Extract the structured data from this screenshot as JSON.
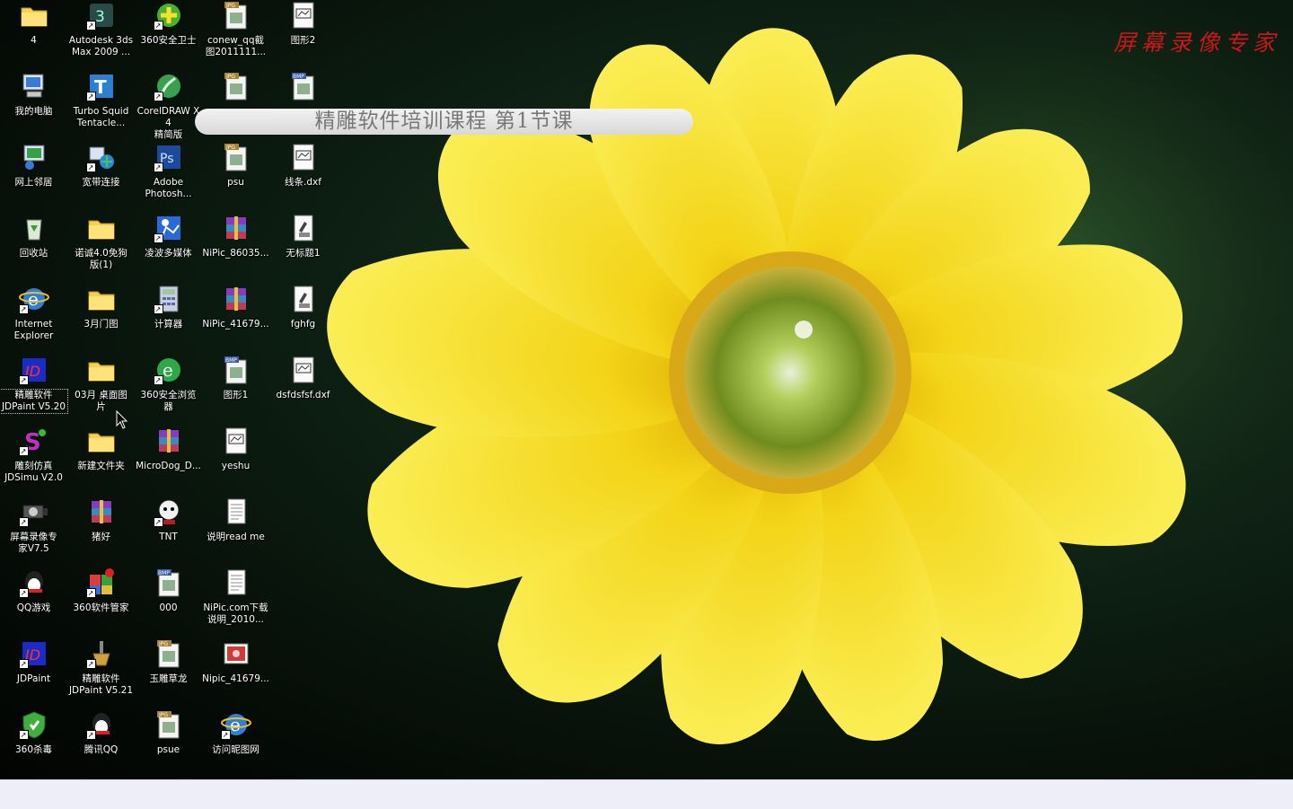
{
  "banner": {
    "text": "精雕软件培训课程    第1节课"
  },
  "watermark": {
    "text": "屏幕录像专家 未"
  },
  "icons": [
    {
      "label": "4",
      "icon": "folder-mail-icon",
      "kind": "folder"
    },
    {
      "label": "我的电脑",
      "icon": "my-computer-icon",
      "kind": "pc"
    },
    {
      "label": "网上邻居",
      "icon": "network-places-icon",
      "kind": "net"
    },
    {
      "label": "回收站",
      "icon": "recycle-bin-icon",
      "kind": "bin"
    },
    {
      "label": "Internet\nExplorer",
      "icon": "internet-explorer-icon",
      "kind": "ie"
    },
    {
      "label": "精雕软件\nJDPaint V5.20",
      "icon": "jdpaint-icon",
      "kind": "jd"
    },
    {
      "label": "雕刻仿真\nJDSimu V2.0",
      "icon": "jdsimu-icon",
      "kind": "simu"
    },
    {
      "label": "屏幕录像专\n家V7.5",
      "icon": "screen-recorder-icon",
      "kind": "cam"
    },
    {
      "label": "QQ游戏",
      "icon": "qq-game-icon",
      "kind": "qq"
    },
    {
      "label": "JDPaint",
      "icon": "jdpaint-icon",
      "kind": "jd"
    },
    {
      "label": "360杀毒",
      "icon": "360-antivirus-icon",
      "kind": "shield"
    },
    {
      "label": "Autodesk 3ds\nMax 2009 ...",
      "icon": "3dsmax-icon",
      "kind": "max"
    },
    {
      "label": "Turbo Squid\nTentacle...",
      "icon": "turbosquid-icon",
      "kind": "ts"
    },
    {
      "label": "宽带连接",
      "icon": "broadband-connection-icon",
      "kind": "net2"
    },
    {
      "label": "诺诚4.0免狗\n版(1)",
      "icon": "folder-icon",
      "kind": "folder"
    },
    {
      "label": "3月门图",
      "icon": "folder-icon",
      "kind": "folder"
    },
    {
      "label": "03月 桌面图\n片",
      "icon": "folder-icon",
      "kind": "folder"
    },
    {
      "label": "新建文件夹",
      "icon": "folder-icon",
      "kind": "folder"
    },
    {
      "label": "猪好",
      "icon": "winrar-icon",
      "kind": "rar"
    },
    {
      "label": "360软件管家",
      "icon": "360-software-manager-icon",
      "kind": "mgr"
    },
    {
      "label": "精雕软件\nJDPaint V5.21",
      "icon": "jdpaint-tool-icon",
      "kind": "tool"
    },
    {
      "label": "腾讯QQ",
      "icon": "tencent-qq-icon",
      "kind": "qq"
    },
    {
      "label": "360安全卫士",
      "icon": "360-safe-icon",
      "kind": "plus"
    },
    {
      "label": "CorelDRAW X4\n精简版",
      "icon": "coreldraw-icon",
      "kind": "corel"
    },
    {
      "label": "Adobe\nPhotosh...",
      "icon": "photoshop-icon",
      "kind": "ps"
    },
    {
      "label": "凌波多媒体",
      "icon": "multimedia-icon",
      "kind": "media"
    },
    {
      "label": "计算器",
      "icon": "calculator-icon",
      "kind": "calc"
    },
    {
      "label": "360安全浏览\n器",
      "icon": "360-browser-icon",
      "kind": "browser"
    },
    {
      "label": "MicroDog_D...",
      "icon": "winrar-icon",
      "kind": "rar"
    },
    {
      "label": "TNT",
      "icon": "tnt-icon",
      "kind": "tnt"
    },
    {
      "label": "000",
      "icon": "bmp-file-icon",
      "kind": "bmp"
    },
    {
      "label": "玉雕草龙",
      "icon": "jpg-file-icon",
      "kind": "jpg"
    },
    {
      "label": "psue",
      "icon": "jpg-file-icon",
      "kind": "jpg"
    },
    {
      "label": "conew_qq截\n图2011111...",
      "icon": "jpg-file-icon",
      "kind": "jpg"
    },
    {
      "label": "",
      "icon": "jpg-file-icon",
      "kind": "jpg"
    },
    {
      "label": "psu",
      "icon": "jpg-file-icon",
      "kind": "jpg"
    },
    {
      "label": "NiPic_86035...",
      "icon": "winrar-icon",
      "kind": "rar"
    },
    {
      "label": "NiPic_41679...",
      "icon": "winrar-icon",
      "kind": "rar"
    },
    {
      "label": "图形1",
      "icon": "bmp-file-icon",
      "kind": "bmp"
    },
    {
      "label": "yeshu",
      "icon": "dxf-file-icon",
      "kind": "dxf"
    },
    {
      "label": "说明read me",
      "icon": "text-file-icon",
      "kind": "txt"
    },
    {
      "label": "NiPic.com下载\n说明_2010...",
      "icon": "text-file-icon",
      "kind": "txt"
    },
    {
      "label": "Nipic_41679...",
      "icon": "image-file-icon",
      "kind": "img"
    },
    {
      "label": "访问昵图网",
      "icon": "ie-link-icon",
      "kind": "ie"
    },
    {
      "label": "图形2",
      "icon": "dxf-file-icon",
      "kind": "dxf"
    },
    {
      "label": "",
      "icon": "bmp-file-icon",
      "kind": "bmp"
    },
    {
      "label": "线条.dxf",
      "icon": "dxf-file-icon",
      "kind": "dxf"
    },
    {
      "label": "无标题1",
      "icon": "jdpaint-doc-icon",
      "kind": "jddoc"
    },
    {
      "label": "fghfg",
      "icon": "jdpaint-doc-icon",
      "kind": "jddoc"
    },
    {
      "label": "dsfdsfsf.dxf",
      "icon": "dxf-file-icon",
      "kind": "dxf"
    }
  ]
}
